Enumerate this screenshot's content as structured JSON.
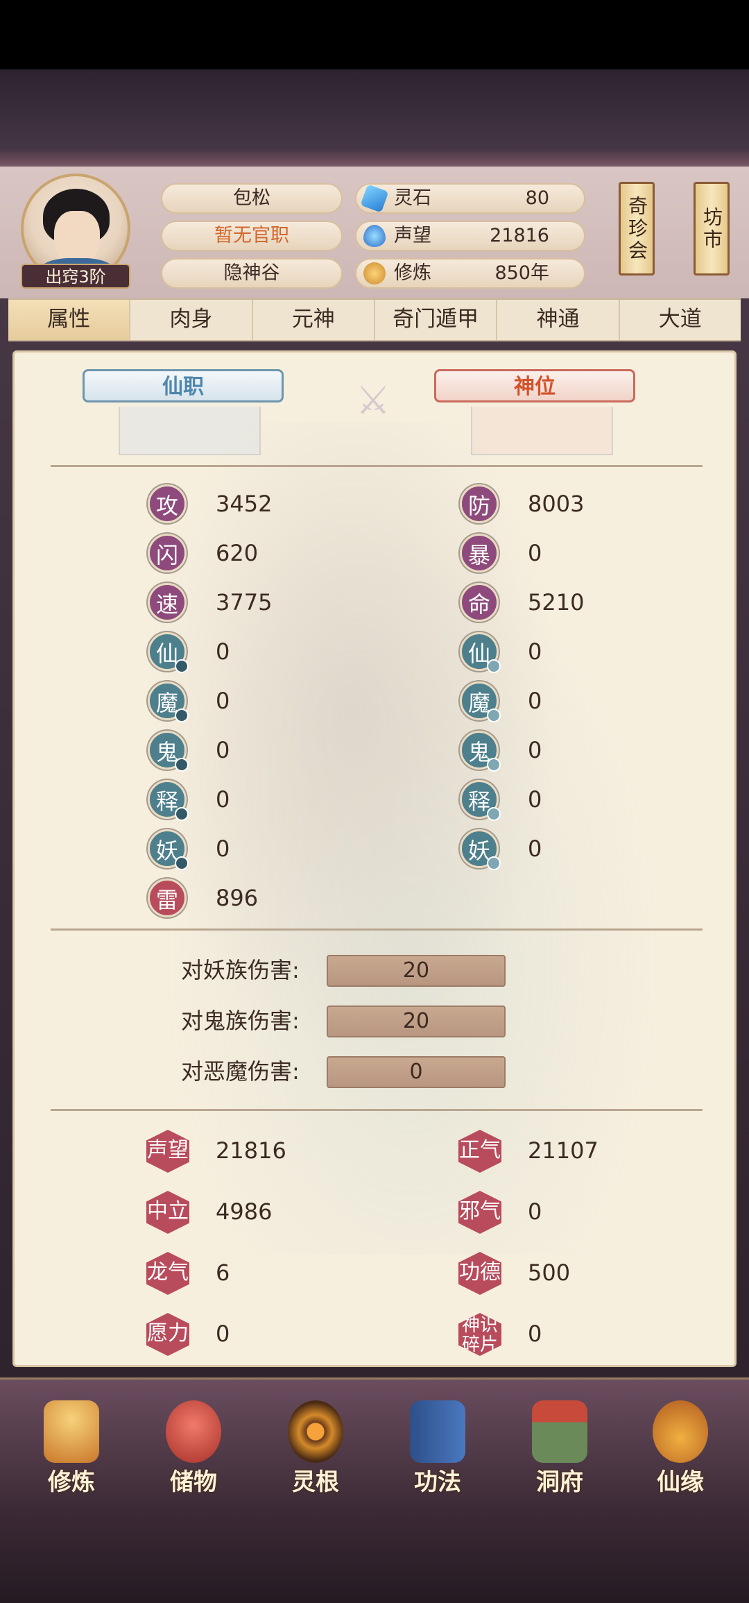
{
  "header": {
    "rank": "出窍3阶",
    "name": "包松",
    "official_title": "暂无官职",
    "sect": "隐神谷",
    "resources": [
      {
        "icon": "spirit-stone-icon",
        "label": "灵石",
        "value": "80"
      },
      {
        "icon": "reputation-icon",
        "label": "声望",
        "value": "21816"
      },
      {
        "icon": "cultivation-icon",
        "label": "修炼",
        "value": "850年"
      }
    ],
    "shortcuts": [
      "奇珍会",
      "坊市"
    ]
  },
  "tabs": [
    "属性",
    "肉身",
    "元神",
    "奇门遁甲",
    "神通",
    "大道"
  ],
  "active_tab": 0,
  "positions": {
    "immortal_post": "仙职",
    "divine_seat": "神位"
  },
  "stats_left": [
    {
      "glyph": "攻",
      "value": "3452",
      "color": "purple"
    },
    {
      "glyph": "闪",
      "value": "620",
      "color": "purple"
    },
    {
      "glyph": "速",
      "value": "3775",
      "color": "purple"
    },
    {
      "glyph": "仙",
      "value": "0",
      "color": "teal"
    },
    {
      "glyph": "魔",
      "value": "0",
      "color": "teal"
    },
    {
      "glyph": "鬼",
      "value": "0",
      "color": "teal"
    },
    {
      "glyph": "释",
      "value": "0",
      "color": "teal"
    },
    {
      "glyph": "妖",
      "value": "0",
      "color": "teal"
    },
    {
      "glyph": "雷",
      "value": "896",
      "color": "red"
    }
  ],
  "stats_right": [
    {
      "glyph": "防",
      "value": "8003",
      "color": "purple"
    },
    {
      "glyph": "暴",
      "value": "0",
      "color": "purple"
    },
    {
      "glyph": "命",
      "value": "5210",
      "color": "purple"
    },
    {
      "glyph": "仙",
      "value": "0",
      "color": "teal"
    },
    {
      "glyph": "魔",
      "value": "0",
      "color": "teal"
    },
    {
      "glyph": "鬼",
      "value": "0",
      "color": "teal"
    },
    {
      "glyph": "释",
      "value": "0",
      "color": "teal"
    },
    {
      "glyph": "妖",
      "value": "0",
      "color": "teal"
    }
  ],
  "damage_bonus": [
    {
      "label": "对妖族伤害:",
      "value": "20"
    },
    {
      "label": "对鬼族伤害:",
      "value": "20"
    },
    {
      "label": "对恶魔伤害:",
      "value": "0"
    }
  ],
  "reputation_left": [
    {
      "label": "声望",
      "value": "21816"
    },
    {
      "label": "中立",
      "value": "4986"
    },
    {
      "label": "龙气",
      "value": "6"
    },
    {
      "label": "愿力",
      "value": "0"
    }
  ],
  "reputation_right": [
    {
      "label": "正气",
      "value": "21107"
    },
    {
      "label": "邪气",
      "value": "0"
    },
    {
      "label": "功德",
      "value": "500"
    },
    {
      "label": "神识碎片",
      "value": "0"
    }
  ],
  "bottom_nav": [
    {
      "label": "修炼",
      "icon": "meditation-icon"
    },
    {
      "label": "储物",
      "icon": "storage-bag-icon"
    },
    {
      "label": "灵根",
      "icon": "spirit-root-icon"
    },
    {
      "label": "功法",
      "icon": "scripture-book-icon"
    },
    {
      "label": "洞府",
      "icon": "cave-abode-icon"
    },
    {
      "label": "仙缘",
      "icon": "gourd-icon"
    }
  ],
  "colors": {
    "purple": "#8e4a7c",
    "teal": "#4d7f8c",
    "red": "#b84c5c",
    "accent_orange": "#d3522b",
    "accent_blue": "#4d86ad"
  }
}
